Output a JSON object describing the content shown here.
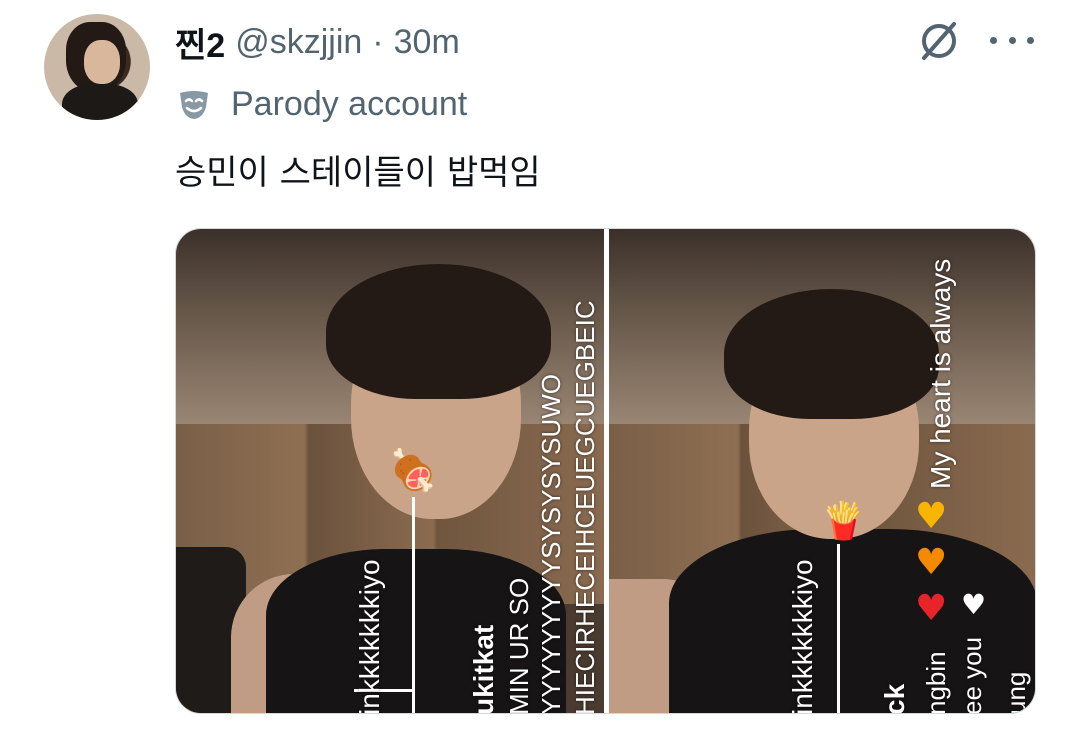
{
  "tweet": {
    "display_name": "찐2",
    "handle": "@skzjjin",
    "separator": "·",
    "time": "30m",
    "label": "Parody account",
    "text": "승민이 스테이들이 밥먹임"
  },
  "icons": {
    "no_entry": "no-entry-icon",
    "more": "more-options-icon",
    "parody": "parody-mask-icon"
  },
  "media": {
    "left": {
      "caption_name": "inkkkkkkkiyo",
      "caption_user": "ukitkat",
      "caption_msg": "MIN UR SO",
      "caption_long1": "YYYYYYYYYSYSYSYSUWO",
      "caption_long2": "HIECIRHECEIHCEUEGCUEGBEIC",
      "emoji": "🍖"
    },
    "right": {
      "caption_name": "inkkkkkkkiyo",
      "caption_user": "ck",
      "caption_msg": "My heart is always",
      "caption_sub1": "ngbin",
      "caption_sub2": "ee you",
      "caption_sub3": "ung",
      "emoji": "🍟"
    }
  },
  "colors": {
    "text_primary": "#0f1419",
    "text_secondary": "#536471",
    "border": "#cfd9de",
    "heart_yellow": "#f7b500",
    "heart_orange": "#f58a00",
    "heart_red": "#e8232a",
    "heart_white": "#ffffff"
  }
}
